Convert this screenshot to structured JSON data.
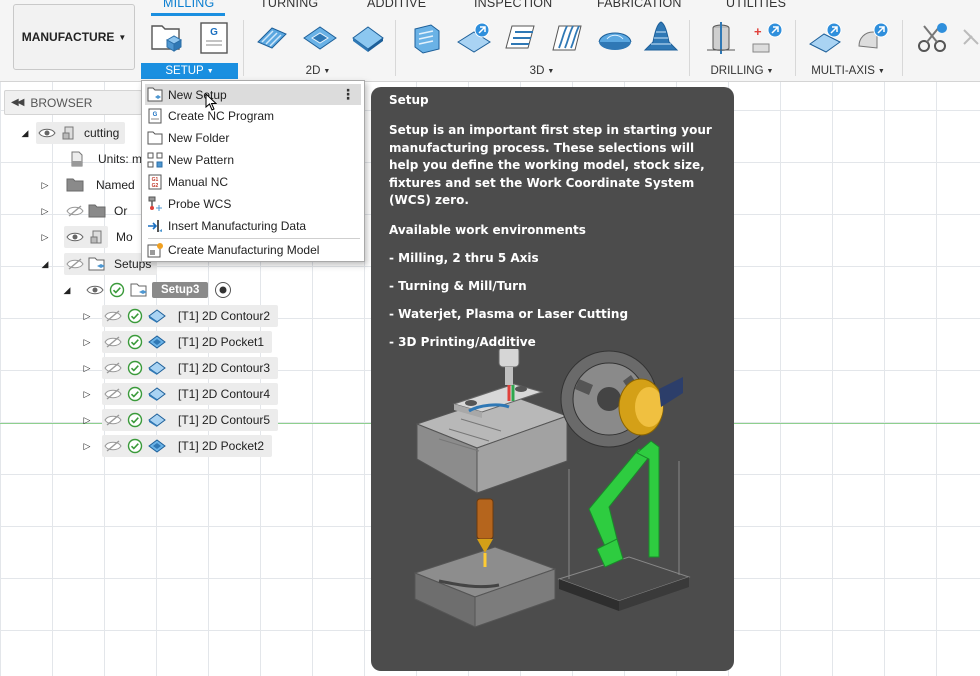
{
  "workspace": {
    "label": "MANUFACTURE"
  },
  "tabs": [
    {
      "label": "MILLING",
      "active": true
    },
    {
      "label": "TURNING"
    },
    {
      "label": "ADDITIVE"
    },
    {
      "label": "INSPECTION"
    },
    {
      "label": "FABRICATION"
    },
    {
      "label": "UTILITIES"
    }
  ],
  "groups": {
    "setup": "SETUP",
    "two_d": "2D",
    "three_d": "3D",
    "drilling": "DRILLING",
    "multi_axis": "MULTI-AXIS"
  },
  "browser": {
    "title": "BROWSER",
    "root": "cutting",
    "units": "Units: m",
    "named": "Named",
    "origin": "Or",
    "models": "Mo",
    "setups": "Setups",
    "setup3": "Setup3",
    "operations": [
      "[T1] 2D Contour2",
      "[T1] 2D Pocket1",
      "[T1] 2D Contour3",
      "[T1] 2D Contour4",
      "[T1] 2D Contour5",
      "[T1] 2D Pocket2"
    ]
  },
  "setup_menu": {
    "items": [
      "New Setup",
      "Create NC Program",
      "New Folder",
      "New Pattern",
      "Manual NC",
      "Probe WCS",
      "Insert Manufacturing Data",
      "Create Manufacturing Model"
    ]
  },
  "tooltip": {
    "title": "Setup",
    "body": "Setup is an important first step in starting your manufacturing process. These selections will help you define the working model, stock size, fixtures and set the Work Coordinate System (WCS) zero.",
    "environments_heading": "Available work environments",
    "environments": [
      "- Milling, 2 thru 5 Axis",
      "- Turning & Mill/Turn",
      "- Waterjet, Plasma or Laser Cutting",
      "- 3D Printing/Additive"
    ]
  },
  "colors": {
    "accent": "#1a8fe0",
    "tooltip_bg": "#4c4c4c",
    "check": "#3a9a3a"
  }
}
